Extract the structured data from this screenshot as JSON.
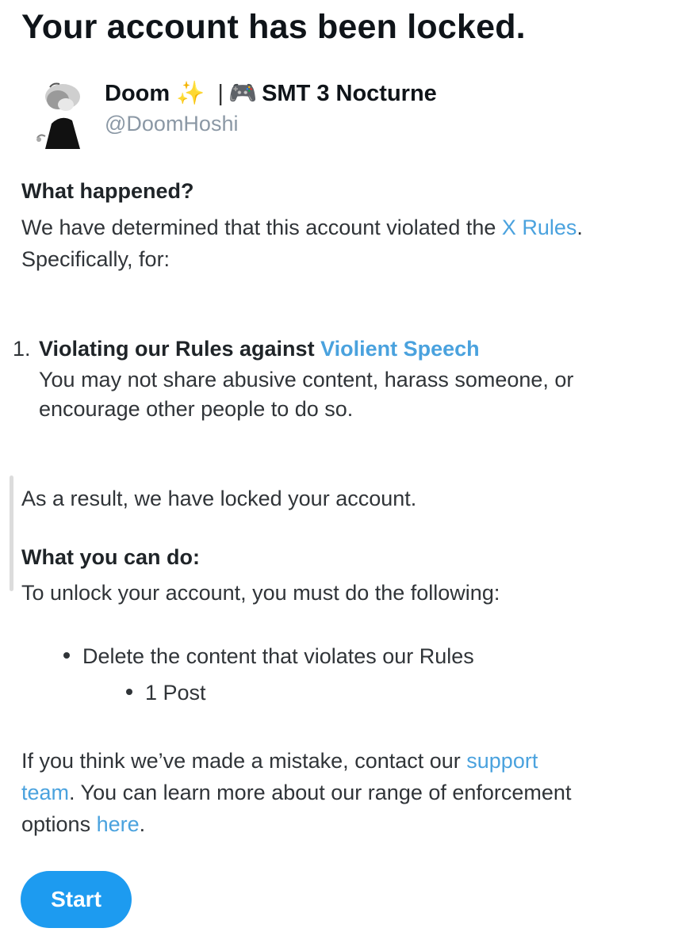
{
  "title": "Your account has been locked.",
  "account": {
    "name_part1": "Doom",
    "sparkle": "✨",
    "separator": "|",
    "gamepad": "🎮",
    "name_part2": "SMT 3 Nocturne",
    "handle": "@DoomHoshi"
  },
  "what_happened": {
    "heading": "What happened?",
    "text_before_link": "We have determined that this account violated the ",
    "link_text": "X Rules",
    "text_after_link": ".",
    "line2": "Specifically, for:"
  },
  "violations": [
    {
      "number": "1.",
      "title_prefix": "Violating our Rules against ",
      "title_link": "Violient Speech",
      "desc_line1": "You may not share abusive content, harass someone, or",
      "desc_line2": "encourage other people to do so."
    }
  ],
  "result_text": "As a result, we have locked your account.",
  "what_you_can_do": {
    "heading": "What you can do:",
    "intro": "To unlock your account, you must do the following:",
    "action": "Delete the content that violates our Rules",
    "sub_action": "1 Post"
  },
  "footer": {
    "line1_text": "If you think we’ve made a mistake, contact our ",
    "line1_link": "support",
    "line2_link": "team",
    "line2_text": ". You can learn more about our range of enforcement",
    "line3_text": "options ",
    "line3_link": "here",
    "line3_end": "."
  },
  "start_button_label": "Start",
  "colors": {
    "link": "#4aa2de",
    "button": "#1d9bf0",
    "handle": "#8b98a5"
  }
}
